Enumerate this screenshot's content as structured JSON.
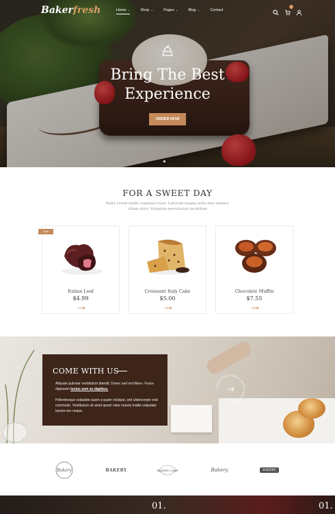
{
  "brand": {
    "name_part1": "Baker",
    "name_part2": "fresh"
  },
  "nav": {
    "items": [
      {
        "label": "Home",
        "caret": "⌄"
      },
      {
        "label": "Shop",
        "caret": "⌄"
      },
      {
        "label": "Pages",
        "caret": "⌄"
      },
      {
        "label": "Blog",
        "caret": "⌄"
      },
      {
        "label": "Contact",
        "caret": ""
      }
    ],
    "active": "Home",
    "icons": [
      "search-icon",
      "cart-icon",
      "user-icon"
    ],
    "cart_count": "0"
  },
  "hero": {
    "title": "Bring The Best\nExperience",
    "button_label": "ORDER NOW",
    "slide_count": 1
  },
  "sweet_day": {
    "title": "FOR A SWEET DAY",
    "subtitle": "Nulla Lorem mollit cupidatat irure. Laborum magna nulla duis ullamco cillum dolor. Voluptate exercitation incididunt",
    "products": [
      {
        "name": "Italian Loaf",
        "price": "$4.99",
        "tag": "Sale"
      },
      {
        "name": "Croissant Italy Cake",
        "price": "$5.00"
      },
      {
        "name": "Chocolate Muffin",
        "price": "$7.55"
      }
    ]
  },
  "come_with_us": {
    "title": "COME WITH US",
    "para1_text": "Aliquam pulvinar vestibulum blandit. Donec sed nisl libero. Fusce dignissim ",
    "para1_link": "luctus sem eu dapibus.",
    "para2": "Pellentesque vulputate quam a quam volutpat, sed ullamcorper erat commodo. Vestibulum sit amet ipsum vitae mauris mattis vulputate lacinia nec neque.",
    "badge_text": "Learn more  Learn more  Learn more"
  },
  "partners": [
    "Bakery",
    "BAKERY",
    "BAKERY CAKE",
    "Bakery",
    "BAKERY"
  ],
  "bottom": {
    "num_left": "01.",
    "num_right": "01."
  },
  "colors": {
    "accent": "#c48a5a",
    "dark_brown": "#3d2519"
  }
}
